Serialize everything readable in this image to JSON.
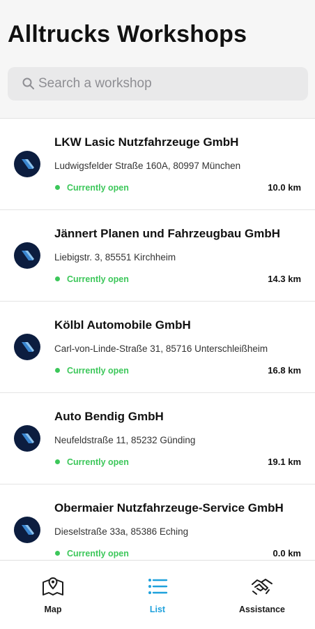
{
  "header": {
    "title": "Alltrucks Workshops"
  },
  "search": {
    "placeholder": "Search a workshop",
    "value": ""
  },
  "colors": {
    "status_open": "#3cc75a",
    "accent": "#1fa1dc",
    "logo_bg": "#0c1d3f"
  },
  "workshops": [
    {
      "name": "LKW Lasic Nutzfahrzeuge GmbH",
      "address": "Ludwigsfelder Straße 160A, 80997 München",
      "status": "Currently open",
      "distance": "10.0 km"
    },
    {
      "name": "Jännert Planen und Fahrzeugbau  GmbH",
      "address": "Liebigstr. 3, 85551 Kirchheim",
      "status": "Currently open",
      "distance": "14.3 km"
    },
    {
      "name": "Kölbl Automobile GmbH",
      "address": "Carl-von-Linde-Straße 31, 85716 Unterschleißheim",
      "status": "Currently open",
      "distance": "16.8 km"
    },
    {
      "name": "Auto Bendig GmbH",
      "address": "Neufeldstraße 11, 85232 Günding",
      "status": "Currently open",
      "distance": "19.1 km"
    },
    {
      "name": "Obermaier Nutzfahrzeuge-Service GmbH",
      "address": "Dieselstraße 33a, 85386 Eching",
      "status": "Currently open",
      "distance": "0.0 km"
    }
  ],
  "tabbar": {
    "tabs": [
      {
        "label": "Map",
        "icon": "map-icon",
        "active": false
      },
      {
        "label": "List",
        "icon": "list-icon",
        "active": true
      },
      {
        "label": "Assistance",
        "icon": "handshake-icon",
        "active": false
      }
    ]
  }
}
